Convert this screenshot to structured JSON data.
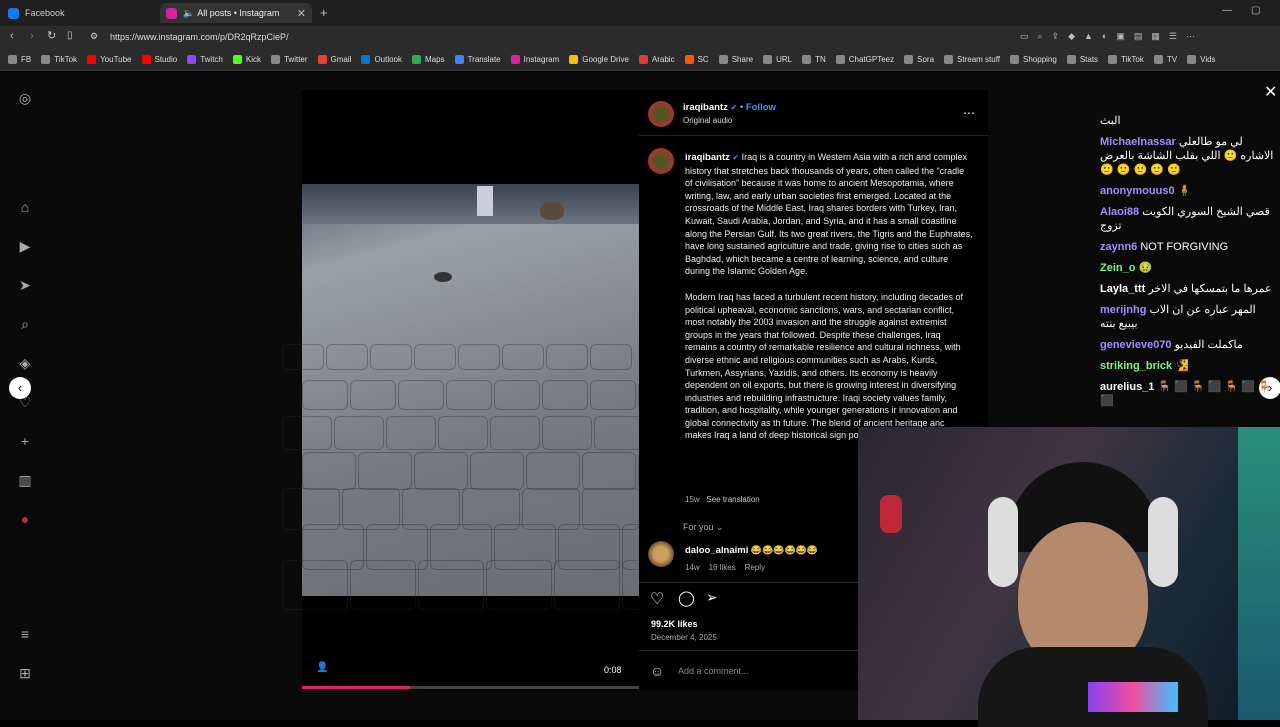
{
  "tabs": [
    {
      "title": "Facebook",
      "color": "#1877f2"
    },
    {
      "title": "All posts • Instagram",
      "color": "#d6249f"
    }
  ],
  "address": {
    "url": "https://www.instagram.com/p/DR2qRzpCieP/"
  },
  "bookmarks": [
    {
      "label": "FB",
      "color": "#888"
    },
    {
      "label": "TikTok",
      "color": "#888"
    },
    {
      "label": "YouTube",
      "color": "#ff0000"
    },
    {
      "label": "Studio",
      "color": "#ff0000"
    },
    {
      "label": "Twitch",
      "color": "#9146ff"
    },
    {
      "label": "Kick",
      "color": "#53fc18"
    },
    {
      "label": "Twitter",
      "color": "#888"
    },
    {
      "label": "Gmail",
      "color": "#ea4335"
    },
    {
      "label": "Outlook",
      "color": "#0078d4"
    },
    {
      "label": "Maps",
      "color": "#34a853"
    },
    {
      "label": "Translate",
      "color": "#4285f4"
    },
    {
      "label": "Instagram",
      "color": "#d6249f"
    },
    {
      "label": "Google Drive",
      "color": "#fbbc04"
    },
    {
      "label": "Arabic",
      "color": "#e53935"
    },
    {
      "label": "SC",
      "color": "#ff5500"
    },
    {
      "label": "Share",
      "color": "#888"
    },
    {
      "label": "URL",
      "color": "#888"
    },
    {
      "label": "TN",
      "color": "#888"
    },
    {
      "label": "ChatGPTeez",
      "color": "#888"
    },
    {
      "label": "Sora",
      "color": "#888"
    },
    {
      "label": "Stream stuff",
      "color": "#888"
    },
    {
      "label": "Shopping",
      "color": "#888"
    },
    {
      "label": "Stats",
      "color": "#888"
    },
    {
      "label": "TikTok",
      "color": "#888"
    },
    {
      "label": "TV",
      "color": "#888"
    },
    {
      "label": "Vids",
      "color": "#888"
    }
  ],
  "post": {
    "username": "iraqibantz",
    "follow": "Follow",
    "audio": "Original audio",
    "caption_p1": "Iraq is a country in Western Asia with a rich and complex history that stretches back thousands of years, often called the “cradle of civilisation” because it was home to ancient Mesopotamia, where writing, law, and early urban societies first emerged. Located at the crossroads of the Middle East, Iraq shares borders with Turkey, Iran, Kuwait, Saudi Arabia, Jordan, and Syria, and it has a small coastline along the Persian Gulf. Its two great rivers, the Tigris and the Euphrates, have long sustained agriculture and trade, giving rise to cities such as Baghdad, which became a centre of learning, science, and culture during the Islamic Golden Age.",
    "caption_p2": "Modern Iraq has faced a turbulent recent history, including decades of political upheaval, economic sanctions, wars, and sectarian conflict, most notably the 2003 invasion and the struggle against extremist groups in the years that followed. Despite these challenges, Iraq remains a country of remarkable resilience and cultural richness, with diverse ethnic and religious communities such as Arabs, Kurds, Turkmen, Assyrians, Yazidis, and others. Its economy is heavily dependent on oil exports, but there is growing interest in diversifying industries and rebuilding infrastructure. Iraqi society values family, tradition, and hospitality, while younger generations ir innovation and global connectivity as th future. The blend of ancient heritage anc makes Iraq a land of deep historical sign potential.",
    "age": "15w",
    "see_translation": "See translation",
    "for_you": "For you",
    "comment": {
      "user": "daloo_alnaimi",
      "text": "😂😂😂😂😂😂",
      "age": "14w",
      "likes": "16 likes",
      "reply": "Reply"
    },
    "likes": "99.2K likes",
    "date": "December 4, 2025",
    "add_comment": "Add a comment...",
    "video_time": "0:08",
    "video_progress": 0.32
  },
  "chat": [
    {
      "user": "",
      "text": "البث",
      "color": "#fff"
    },
    {
      "user": "Michaelnassar",
      "text": "لي مو طالعلي الاشاره 🙂 اللي بقلب الشاشة بالعرض 🙂 🙂 🙂 🙂 🙂",
      "color": "#a58dff"
    },
    {
      "user": "anonymouus0",
      "text": "🧍",
      "color": "#a58dff"
    },
    {
      "user": "Alaoi88",
      "text": "قصي الشيخ السوري الكويت تزوج",
      "color": "#a58dff"
    },
    {
      "user": "zaynn6",
      "text": "NOT FORGIVING",
      "color": "#a58dff"
    },
    {
      "user": "Zein_o",
      "text": "🤢",
      "color": "#7df27d"
    },
    {
      "user": "Layla_ttt",
      "text": "عمرها ما بتمسكها في الاخر",
      "color": "#fff"
    },
    {
      "user": "merijnhg",
      "text": "المهر عباره عن ان الاب بيبيع بنته",
      "color": "#a58dff"
    },
    {
      "user": "genevieve070",
      "text": "ماكملت الفيديو",
      "color": "#a58dff"
    },
    {
      "user": "striking_brick",
      "text": "🧏",
      "color": "#7df27d"
    },
    {
      "user": "aurelius_1",
      "text": "🪑 ⬛ 🪑 ⬛ 🪑 ⬛ 🪑 ⬛",
      "color": "#fff"
    }
  ]
}
